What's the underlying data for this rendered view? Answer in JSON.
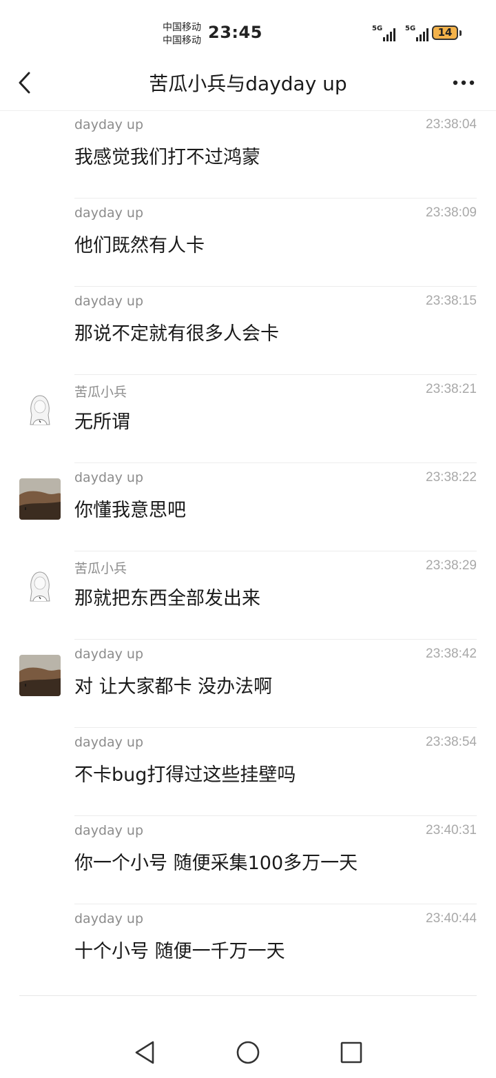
{
  "status_bar": {
    "carrier_1": "中国移动",
    "carrier_2": "中国移动",
    "time": "23:45",
    "signal_1": "5G",
    "signal_2": "5G",
    "battery": "14"
  },
  "header": {
    "title": "苦瓜小兵与dayday up",
    "back_icon": "chevron-left-icon",
    "more_icon": "more-dots-icon"
  },
  "messages": [
    {
      "sender": "dayday up",
      "time": "23:38:04",
      "text": "我感觉我们打不过鸿蒙",
      "avatar": "none"
    },
    {
      "sender": "dayday up",
      "time": "23:38:09",
      "text": "他们既然有人卡",
      "avatar": "none"
    },
    {
      "sender": "dayday up",
      "time": "23:38:15",
      "text": "那说不定就有很多人会卡",
      "avatar": "none"
    },
    {
      "sender": "苦瓜小兵",
      "time": "23:38:21",
      "text": "无所谓",
      "avatar": "sketch-girl"
    },
    {
      "sender": "dayday up",
      "time": "23:38:22",
      "text": "你懂我意思吧",
      "avatar": "landscape"
    },
    {
      "sender": "苦瓜小兵",
      "time": "23:38:29",
      "text": "那就把东西全部发出来",
      "avatar": "sketch-girl"
    },
    {
      "sender": "dayday up",
      "time": "23:38:42",
      "text": "对 让大家都卡 没办法啊",
      "avatar": "landscape"
    },
    {
      "sender": "dayday up",
      "time": "23:38:54",
      "text": "不卡bug打得过这些挂壁吗",
      "avatar": "none"
    },
    {
      "sender": "dayday up",
      "time": "23:40:31",
      "text": "你一个小号 随便采集100多万一天",
      "avatar": "none"
    },
    {
      "sender": "dayday up",
      "time": "23:40:44",
      "text": "十个小号 随便一千万一天",
      "avatar": "none"
    }
  ],
  "nav": {
    "back_icon": "triangle-back-icon",
    "home_icon": "circle-home-icon",
    "recents_icon": "square-recents-icon"
  }
}
